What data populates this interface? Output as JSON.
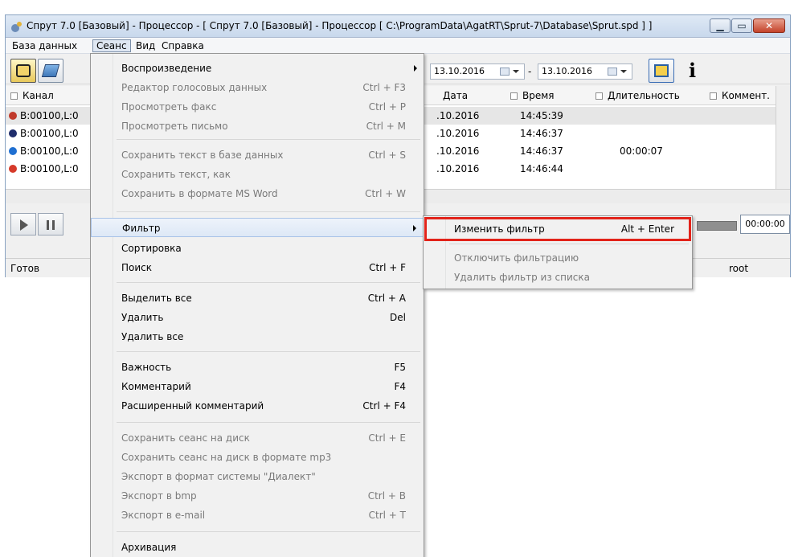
{
  "window": {
    "title": "Спрут 7.0 [Базовый] - Процессор - [ Спрут 7.0 [Базовый] - Процессор [ C:\\ProgramData\\AgatRT\\Sprut-7\\Database\\Sprut.spd ] ]"
  },
  "menubar": {
    "items": [
      "База данных",
      "Сеанс",
      "Вид",
      "Справка"
    ],
    "active": "Сеанс"
  },
  "toolbar": {
    "date_from": "13.10.2016",
    "date_sep": "-",
    "date_to": "13.10.2016"
  },
  "grid": {
    "columns": [
      "Канал",
      "Дата",
      "Время",
      "Длительность",
      "Коммент."
    ],
    "rows": [
      {
        "channel": "B:00100,L:0",
        "date": ".10.2016",
        "time": "14:45:39",
        "duration": ""
      },
      {
        "channel": "B:00100,L:0",
        "date": ".10.2016",
        "time": "14:46:37",
        "duration": ""
      },
      {
        "channel": "B:00100,L:0",
        "date": ".10.2016",
        "time": "14:46:37",
        "duration": "00:00:07"
      },
      {
        "channel": "B:00100,L:0",
        "date": ".10.2016",
        "time": "14:46:44",
        "duration": ""
      }
    ],
    "row_icon_colors": [
      "#c0392b",
      "#1f2d6b",
      "#1f6fd1",
      "#d63a2a"
    ]
  },
  "player": {
    "time": "00:00:00"
  },
  "status": {
    "left": "Готов",
    "user": "root"
  },
  "session_menu": {
    "items": [
      {
        "label": "Воспроизведение",
        "shortcut": "",
        "disabled": false,
        "submenu": true
      },
      {
        "label": "Редактор голосовых данных",
        "shortcut": "Ctrl + F3",
        "disabled": true
      },
      {
        "label": "Просмотреть факс",
        "shortcut": "Ctrl + P",
        "disabled": true
      },
      {
        "label": "Просмотреть письмо",
        "shortcut": "Ctrl + M",
        "disabled": true
      },
      {
        "label": "Сохранить текст в базе данных",
        "shortcut": "Ctrl + S",
        "disabled": true
      },
      {
        "label": "Сохранить текст, как",
        "shortcut": "",
        "disabled": true
      },
      {
        "label": "Сохранить в формате MS Word",
        "shortcut": "Ctrl + W",
        "disabled": true
      },
      {
        "label": "Фильтр",
        "shortcut": "",
        "disabled": false,
        "submenu": true
      },
      {
        "label": "Сортировка",
        "shortcut": "",
        "disabled": false
      },
      {
        "label": "Поиск",
        "shortcut": "Ctrl + F",
        "disabled": false
      },
      {
        "label": "Выделить все",
        "shortcut": "Ctrl + A",
        "disabled": false
      },
      {
        "label": "Удалить",
        "shortcut": "Del",
        "disabled": false
      },
      {
        "label": "Удалить все",
        "shortcut": "",
        "disabled": false
      },
      {
        "label": "Важность",
        "shortcut": "F5",
        "disabled": false
      },
      {
        "label": "Комментарий",
        "shortcut": "F4",
        "disabled": false
      },
      {
        "label": "Расширенный комментарий",
        "shortcut": "Ctrl + F4",
        "disabled": false
      },
      {
        "label": "Сохранить сеанс на диск",
        "shortcut": "Ctrl + E",
        "disabled": true
      },
      {
        "label": "Сохранить сеанс на диск в формате mp3",
        "shortcut": "",
        "disabled": true
      },
      {
        "label": "Экспорт в формат системы \"Диалект\"",
        "shortcut": "",
        "disabled": true
      },
      {
        "label": "Экспорт в bmp",
        "shortcut": "Ctrl + B",
        "disabled": true
      },
      {
        "label": "Экспорт в e-mail",
        "shortcut": "Ctrl + T",
        "disabled": true
      },
      {
        "label": "Архивация",
        "shortcut": "",
        "disabled": false
      }
    ]
  },
  "filter_submenu": {
    "items": [
      {
        "label": "Изменить фильтр",
        "shortcut": "Alt + Enter",
        "disabled": false
      },
      {
        "label": "Отключить фильтрацию",
        "shortcut": "",
        "disabled": true
      },
      {
        "label": "Удалить фильтр из списка",
        "shortcut": "",
        "disabled": true
      }
    ]
  },
  "colors": {
    "highlight_box": "#e2231a"
  }
}
